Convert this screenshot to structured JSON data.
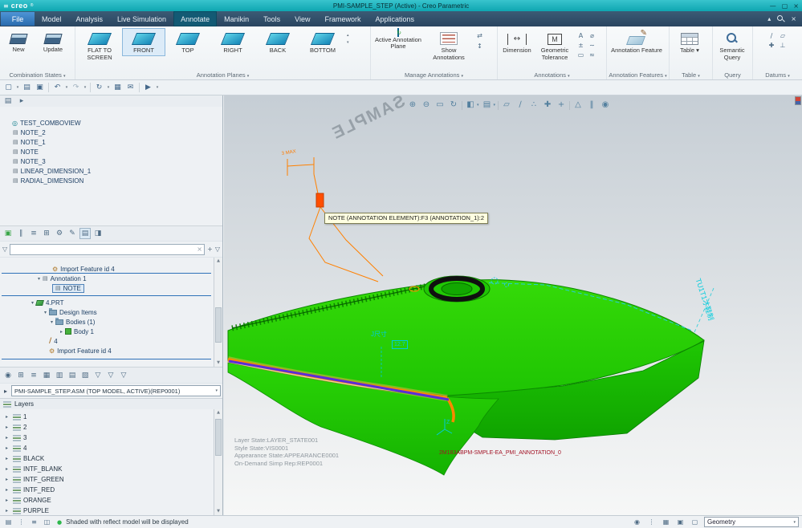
{
  "window": {
    "logo": "creo",
    "logo_mark": "®",
    "title": "PMI-SAMPLE_STEP (Active) - Creo Parametric"
  },
  "tabs": {
    "file": "File",
    "items": [
      "Model",
      "Analysis",
      "Live Simulation",
      "Annotate",
      "Manikin",
      "Tools",
      "View",
      "Framework",
      "Applications"
    ],
    "active": "Annotate"
  },
  "ribbon": {
    "combination_states": {
      "label": "Combination States",
      "new": "New",
      "update": "Update"
    },
    "annotation_planes": {
      "label": "Annotation Planes",
      "flat": "FLAT TO SCREEN",
      "front": "FRONT",
      "top": "TOP",
      "right": "RIGHT",
      "back": "BACK",
      "bottom": "BOTTOM"
    },
    "manage_annotations": {
      "label": "Manage Annotations",
      "active_plane": "Active Annotation Plane",
      "show": "Show Annotations"
    },
    "annotations": {
      "label": "Annotations",
      "dimension": "Dimension",
      "geometric_tolerance": "Geometric Tolerance"
    },
    "annotation_features": {
      "label": "Annotation Features",
      "feature": "Annotation Feature"
    },
    "table": {
      "label": "Table",
      "item": "Table"
    },
    "query": {
      "label": "Query",
      "item": "Semantic Query"
    },
    "datums": {
      "label": "Datums"
    }
  },
  "tree1": {
    "root": "TEST_COMBOVIEW",
    "items": [
      "NOTE_2",
      "NOTE_1",
      "NOTE",
      "NOTE_3",
      "LINEAR_DIMENSION_1",
      "RADIAL_DIMENSION"
    ]
  },
  "tree2": {
    "items": [
      {
        "label": "Import Feature id 4",
        "arrow": ""
      },
      {
        "label": "Annotation 1",
        "arrow": "▾"
      },
      {
        "label": "NOTE",
        "arrow": ""
      },
      {
        "label": "4.PRT",
        "arrow": "▾"
      },
      {
        "label": "Design Items",
        "arrow": "▾"
      },
      {
        "label": "Bodies (1)",
        "arrow": "▾"
      },
      {
        "label": "Body 1",
        "arrow": "▸"
      },
      {
        "label": "4",
        "arrow": ""
      },
      {
        "label": "Import Feature id 4",
        "arrow": ""
      }
    ]
  },
  "model_selector": {
    "value": "PMI-SAMPLE_STEP.ASM (TOP MODEL, ACTIVE)(REP0001)"
  },
  "layers": {
    "header": "Layers",
    "items": [
      "1",
      "2",
      "3",
      "4",
      "BLACK",
      "INTF_BLANK",
      "INTF_GREEN",
      "INTF_RED",
      "ORANGE",
      "PURPLE"
    ]
  },
  "status": {
    "message": "Shaded with reflect model will be displayed",
    "selection_filter": "Geometry"
  },
  "graphics": {
    "tooltip": "NOTE (ANNOTATION ELEMENT):F3 (ANNOTATION_1):2",
    "sample": "SAMPLE",
    "max_note": "3 MAX",
    "states": [
      "Layer State:LAYER_STATE001",
      "Style State:VIS0001",
      "Appearance State:APPEARANCE0001",
      "On-Demand Simp Rep:REP0001"
    ],
    "red_note": "2M183ABPM-SMPLE-EA_PMI_ANNOTATION_0",
    "side_note": "TU1T1才鞋制",
    "mid_note": "J尺寸",
    "dim_value": "12.7",
    "axis_label": "Z"
  },
  "icons": {
    "menu": "≡",
    "win_min": "—",
    "win_max": "▢",
    "win_close": "×",
    "ribbon_collapse": "▴",
    "tab_close": "×",
    "caret": "▾",
    "caret_up": "▴",
    "expand": "▸",
    "q_new": "▢",
    "q_open": "▤",
    "q_save": "▣",
    "q_undo": "↶",
    "q_redo": "↷",
    "q_regen": "↻",
    "q_windows": "▦",
    "q_mail": "✉",
    "q_play": "▶",
    "spin_up": "▴",
    "spin_down": "▾",
    "mini_swap": "⇄",
    "mini_updown": "↕",
    "a_text": "A",
    "a_dia": "⌀",
    "a_pm": "±",
    "a_wave": "∼",
    "a_box": "▭",
    "a_approx": "≈",
    "d_axis": "∕",
    "d_plane": "▱",
    "d_cross": "✚",
    "d_perp": "⊥",
    "dim_arrow": "↔",
    "gt_letter": "M",
    "t1_tree": "▤",
    "t1_go": "▸",
    "t2_1": "▣",
    "t2_2": "∥",
    "t2_3": "≡",
    "t2_4": "⊞",
    "t2_5": "⚙",
    "t2_6": "✎",
    "t2_7": "▤",
    "t2_8": "◨",
    "funnel": "▽",
    "plus": "+",
    "clear": "×",
    "t3_1": "◉",
    "t3_2": "⊞",
    "t3_3": "≡",
    "t3_4": "▦",
    "t3_5": "▥",
    "t3_6": "▤",
    "t3_7": "▧",
    "t3_8": "▽",
    "t3_9": "▽",
    "t3_10": "▽",
    "s_1": "▤",
    "s_2": "⋮",
    "s_3": "≡",
    "s_4": "◫",
    "sr_1": "◉",
    "sr_2": "⋮",
    "sr_3": "▦",
    "sr_4": "▣",
    "sr_5": "▢",
    "g_zoom_in": "⊕",
    "g_zoom_out": "⊖",
    "g_refit": "▭",
    "g_repaint": "↻",
    "g_style": "◧",
    "g_views": "▤",
    "g_plane": "▱",
    "g_axis": "∕",
    "g_point": "∴",
    "g_csys": "✚",
    "g_spin": "+",
    "g_persp": "△",
    "g_pause": "‖",
    "g_cam": "◉",
    "dot": "●",
    "gear": "⚙",
    "note": "▤",
    "eye": "◎",
    "axis": "∕"
  }
}
